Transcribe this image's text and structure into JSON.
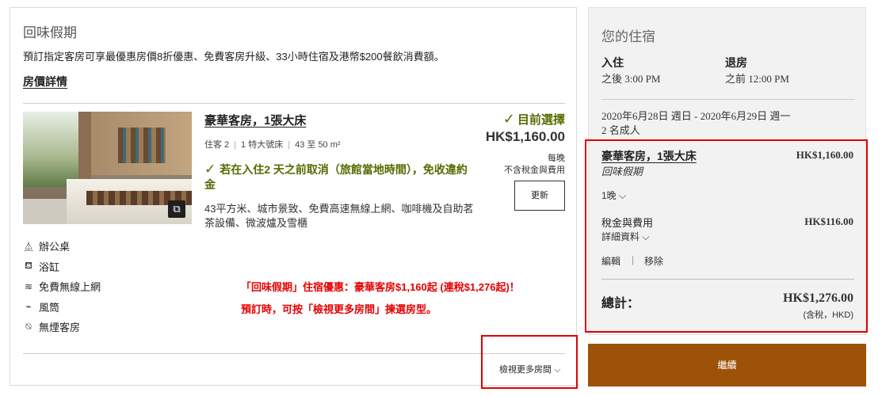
{
  "package": {
    "title": "回味假期",
    "description": "預訂指定客房可享最優惠房價8折優惠、免費客房升級、33小時住宿及港幣$200餐飲消費額。",
    "rate_details_link": "房價詳情"
  },
  "room": {
    "name": "豪華客房，1張大床",
    "guests": "住客 2",
    "bed": "1 特大號床",
    "size": "43 至 50 m²",
    "cancellation": "若在入住2 天之前取消（旅館當地時間），免收違約金",
    "features": "43平方米、城市景致、免費高速無線上網、咖啡機及自助茗茶設備、微波爐及雪櫃",
    "current_selection": "目前選擇",
    "price": "HK$1,160.00",
    "per_night": "每晚",
    "excl_taxes": "不含稅金與費用",
    "update_button": "更新",
    "gallery_icon": "gallery-icon"
  },
  "amenities": [
    {
      "icon": "desk-icon",
      "glyph": "⏅",
      "label": "辦公桌"
    },
    {
      "icon": "bathtub-icon",
      "glyph": "🛁",
      "label": "浴缸"
    },
    {
      "icon": "wifi-icon",
      "glyph": "≋",
      "label": "免費無線上網"
    },
    {
      "icon": "hairdryer-icon",
      "glyph": "⌁",
      "label": "風筒"
    },
    {
      "icon": "no-smoking-icon",
      "glyph": "⍉",
      "label": "無煙客房"
    }
  ],
  "promo": {
    "line1": "「回味假期」住宿優惠：豪華客房$1,160起 (連稅$1,276起)！",
    "line2": "預訂時，可按「檢視更多房間」揀選房型。"
  },
  "view_more": "檢視更多房間",
  "stay": {
    "title": "您的住宿",
    "checkin_label": "入住",
    "checkin_value": "之後 3:00 PM",
    "checkout_label": "退房",
    "checkout_value": "之前 12:00 PM",
    "dates": "2020年6月28日 週日 - 2020年6月29日 週一",
    "guests": "2 名成人"
  },
  "summary": {
    "room_name": "豪華客房，1張大床",
    "room_price": "HK$1,160.00",
    "package_name": "回味假期",
    "nights": "1晚",
    "tax_label": "稅金與費用",
    "tax_price": "HK$116.00",
    "details": "詳細資料",
    "edit": "編輯",
    "separator": "|",
    "remove": "移除",
    "total_label": "總計：",
    "total_price": "HK$1,276.00",
    "total_note": "(含稅，HKD)"
  },
  "continue_button": "繼續",
  "colors": {
    "accent_green": "#556b00",
    "highlight_red": "#e00000",
    "continue_brown": "#9c5307"
  }
}
